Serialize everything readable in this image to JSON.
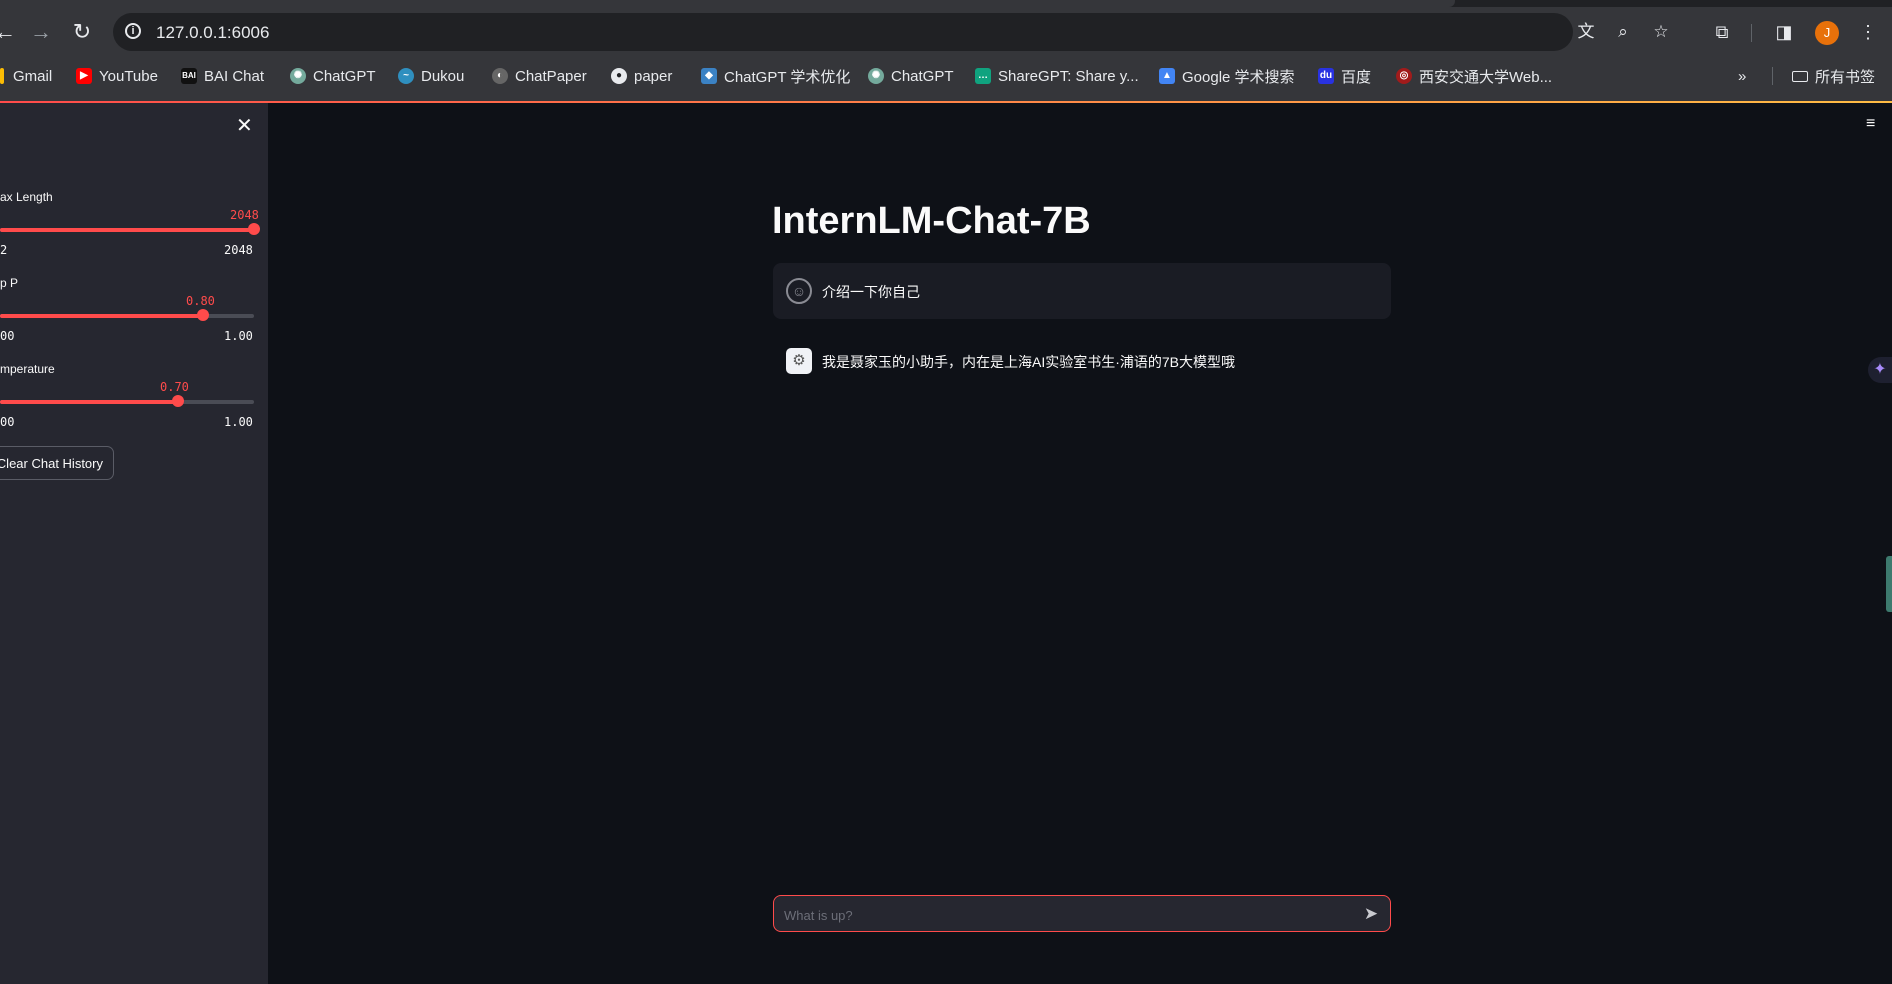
{
  "browser": {
    "url": "127.0.0.1:6006",
    "avatar_letter": "J",
    "bookmarks": [
      {
        "label": "Gmail",
        "icon": "gmail-icon"
      },
      {
        "label": "YouTube",
        "icon": "youtube-icon"
      },
      {
        "label": "BAI Chat",
        "icon": "baichat-icon"
      },
      {
        "label": "ChatGPT",
        "icon": "chatgpt-icon"
      },
      {
        "label": "Dukou",
        "icon": "dukou-icon"
      },
      {
        "label": "ChatPaper",
        "icon": "chatpaper-icon"
      },
      {
        "label": "paper",
        "icon": "github-icon"
      },
      {
        "label": "ChatGPT 学术优化",
        "icon": "academic-icon"
      },
      {
        "label": "ChatGPT",
        "icon": "chatgpt-icon"
      },
      {
        "label": "ShareGPT: Share y...",
        "icon": "sharegpt-icon"
      },
      {
        "label": "Google 学术搜索",
        "icon": "scholar-icon"
      },
      {
        "label": "百度",
        "icon": "baidu-icon"
      },
      {
        "label": "西安交通大学Web...",
        "icon": "xjtu-icon"
      }
    ],
    "bookmarks_folder": "所有书签"
  },
  "sidebar": {
    "sliders": [
      {
        "label": "ax Length",
        "value": "2048",
        "min_label": "2",
        "max_label": "2048",
        "fraction": 1.0
      },
      {
        "label": "p P",
        "value": "0.80",
        "min_label": "00",
        "max_label": "1.00",
        "fraction": 0.8
      },
      {
        "label": "mperature",
        "value": "0.70",
        "min_label": "00",
        "max_label": "1.00",
        "fraction": 0.7
      }
    ],
    "clear_button": "Clear Chat History"
  },
  "main": {
    "title": "InternLM-Chat-7B",
    "messages": [
      {
        "role": "user",
        "text": "介绍一下你自己"
      },
      {
        "role": "assistant",
        "text": "我是聂家玉的小助手，内在是上海AI实验室书生·浦语的7B大模型哦"
      }
    ],
    "input_placeholder": "What is up?"
  },
  "colors": {
    "accent": "#ff4b4b",
    "background": "#0e1117",
    "sidebar": "#262730"
  }
}
